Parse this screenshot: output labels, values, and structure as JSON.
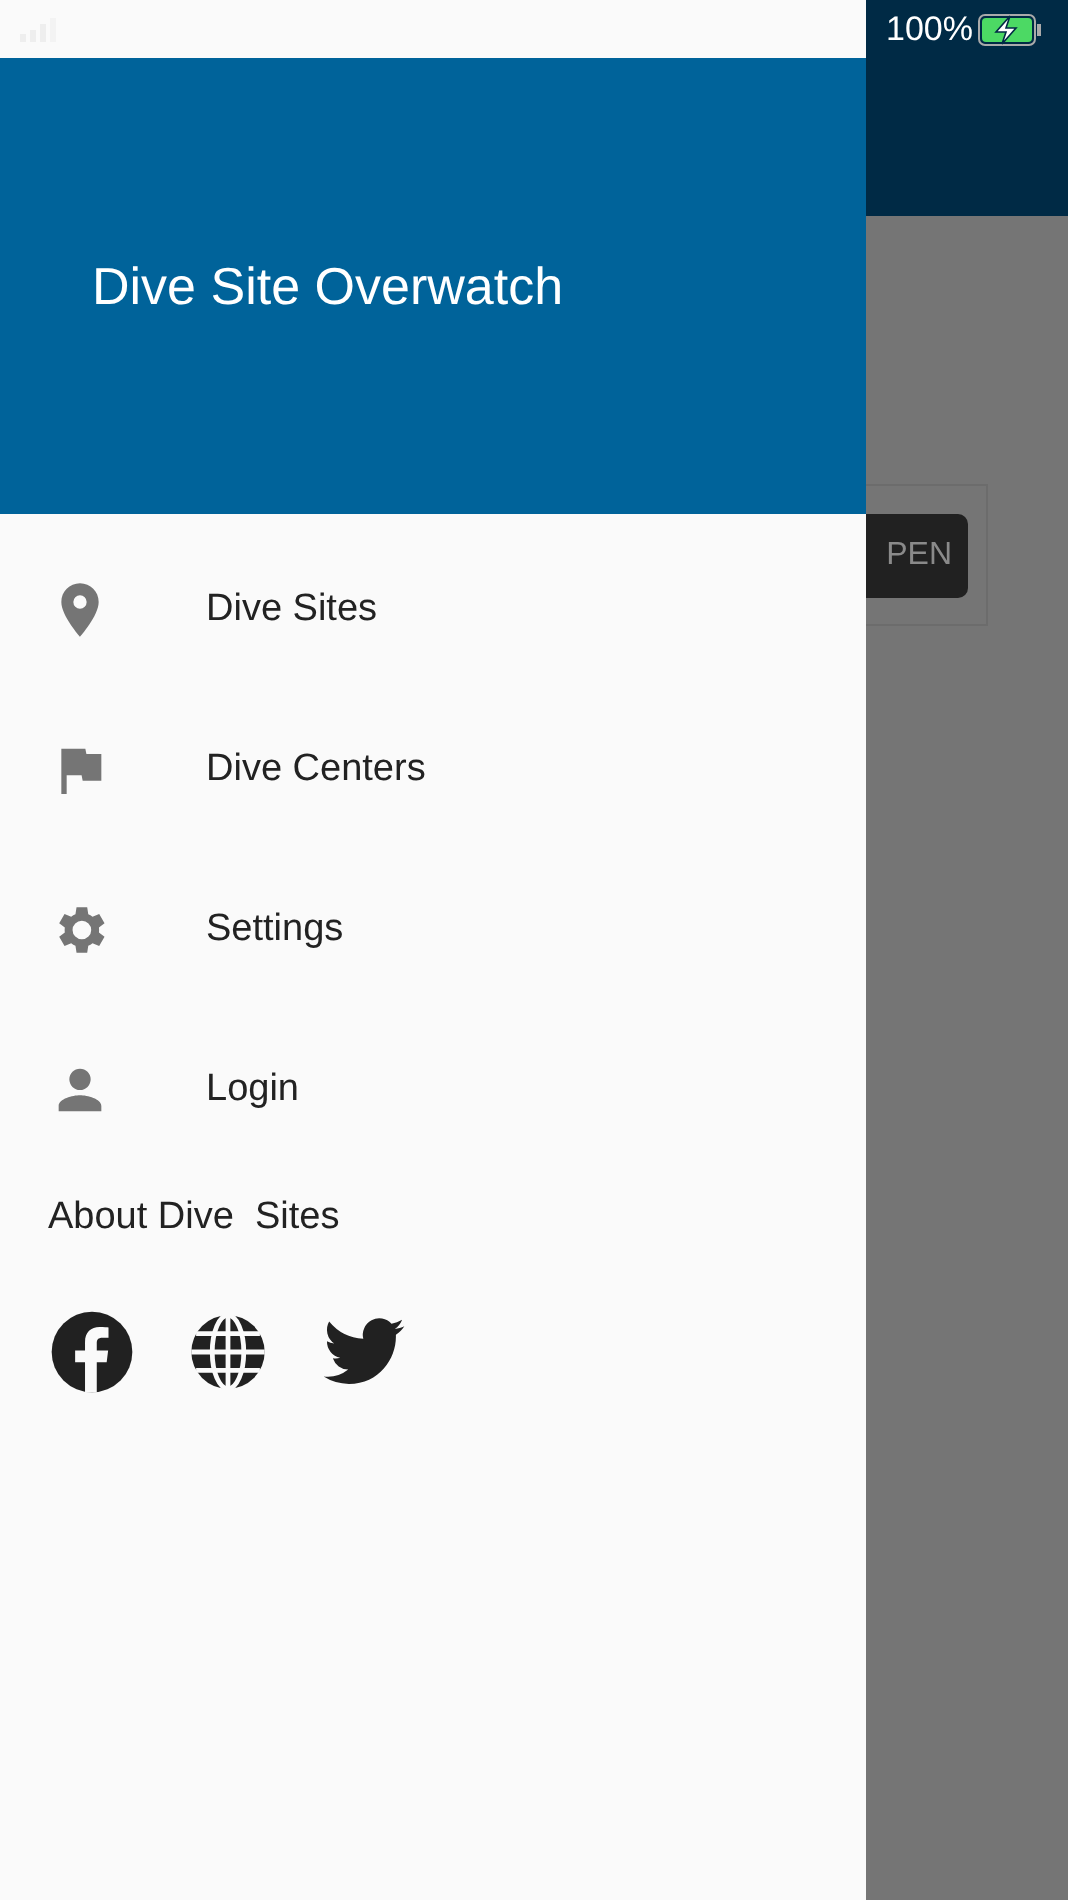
{
  "status_bar": {
    "battery": "100%",
    "charging": true
  },
  "drawer": {
    "title": "Dive Site Overwatch",
    "items": [
      {
        "label": "Dive Sites"
      },
      {
        "label": "Dive Centers"
      },
      {
        "label": "Settings"
      },
      {
        "label": "Login"
      }
    ],
    "about": {
      "heading": "About Dive  Sites"
    }
  },
  "background": {
    "button": "PEN"
  }
}
